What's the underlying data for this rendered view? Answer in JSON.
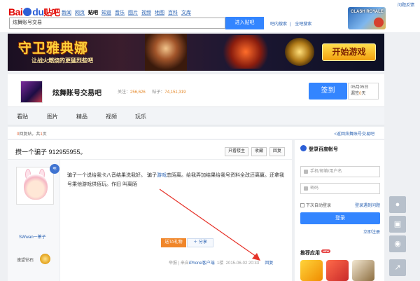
{
  "header": {
    "logo_bai": "Bai",
    "logo_du": "du",
    "logo_tieba": "贴吧",
    "nav": [
      "新闻",
      "网页",
      "贴吧",
      "知道",
      "音乐",
      "图片",
      "视频",
      "地图",
      "百科",
      "文库"
    ],
    "active_nav": "贴吧",
    "search_value": "炫舞账号交易",
    "search_button": "进入贴吧",
    "search_links": [
      "吧内搜索",
      "全吧搜索"
    ],
    "help_link": "问题反馈",
    "top_ad_text": "CLASH ROYALE"
  },
  "banner": {
    "title": "守卫雅典娜",
    "subtitle": "让战火燃烧的更猛烈些吧",
    "cta": "开始游戏"
  },
  "forum": {
    "name": "炫舞账号交易吧",
    "members_label": "关注：",
    "members": "256,626",
    "posts_label": "帖子：",
    "posts": "74,151,319",
    "sign_button": "签到",
    "sign_date": "05月05日",
    "sign_rank_prefix": "漏签",
    "sign_rank_days": "0",
    "sign_rank_suffix": "天"
  },
  "tabs": [
    "看贴",
    "图片",
    "精品",
    "视频",
    "玩乐"
  ],
  "crumbs": {
    "reply_count": "0",
    "reply_suffix": "回复贴，共",
    "page_count": "1",
    "page_suffix": "页",
    "back_link": "<返回炫舞账号交易吧"
  },
  "post": {
    "title": "攒一个骗子 912955955。",
    "buttons": [
      "只看楼主",
      "收藏",
      "回复"
    ],
    "author": "SWwan一箫子",
    "author_badge": "吧",
    "author_level": "速望钻石",
    "body_1": "骗子一个说给我卡八音结果洗我好。 骗子",
    "body_link": "游戏",
    "body_2": "恋陌离。给我弄加结果给我号资料全改还离嬴。还拿我号乘他游戏供佰玩。作旧 叫离陌",
    "gift_button": "送TA礼物",
    "share_button": "分享",
    "footer_report": "举报",
    "footer_from": "来自",
    "footer_client": "iPhone客户端",
    "footer_floor": "1楼",
    "footer_time": "2015-06-02 20:33",
    "footer_reply": "回复"
  },
  "sidebar": {
    "login_title": "登录百度帐号",
    "username_placeholder": "手机/邮箱/用户名",
    "password_placeholder": "密码",
    "remember_label": "下次自动登录",
    "forgot_link": "登录遇到问题",
    "login_button": "登录",
    "register_link": "立即注册",
    "recommend_title": "推荐应用",
    "new_badge": "NEW"
  },
  "floatbar": {
    "icons": [
      "location-icon",
      "shop-icon",
      "bear-icon",
      "share-icon"
    ]
  },
  "colors": {
    "brand_blue": "#3385ff",
    "link_blue": "#2d64b3",
    "accent_orange": "#f0862a",
    "baidu_red": "#e10601"
  }
}
